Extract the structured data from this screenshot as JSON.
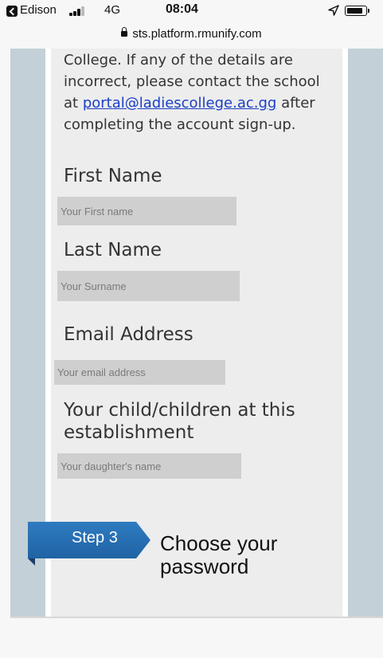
{
  "status_bar": {
    "back_app": "Edison",
    "network": "4G",
    "time": "08:04"
  },
  "browser": {
    "url": "sts.platform.rmunify.com"
  },
  "intro": {
    "text_before": "College. If any of the details are incorrect, please contact the school at ",
    "email_link": "portal@ladiescollege.ac.gg",
    "text_after": " after completing the account sign-up."
  },
  "form": {
    "first_name": {
      "label": "First Name",
      "placeholder": "Your First name",
      "value": ""
    },
    "last_name": {
      "label": "Last Name",
      "placeholder": "Your Surname",
      "value": ""
    },
    "email": {
      "label": "Email Address",
      "placeholder": "Your email address",
      "value": ""
    },
    "children": {
      "label": "Your child/children at this establishment",
      "placeholder": "Your daughter's name",
      "value": ""
    }
  },
  "step": {
    "label": "Step 3",
    "title": "Choose your password"
  },
  "colors": {
    "accent_blue": "#2b73b8",
    "link_blue": "#1a3fc6",
    "page_bg": "#c3d0d7",
    "panel_bg": "#ededed",
    "field_bg": "#cfcfcf"
  },
  "icons": {
    "back": "back-to-app-icon",
    "signal": "cellular-signal-icon",
    "location": "location-arrow-icon",
    "battery": "battery-icon",
    "lock": "lock-icon"
  }
}
